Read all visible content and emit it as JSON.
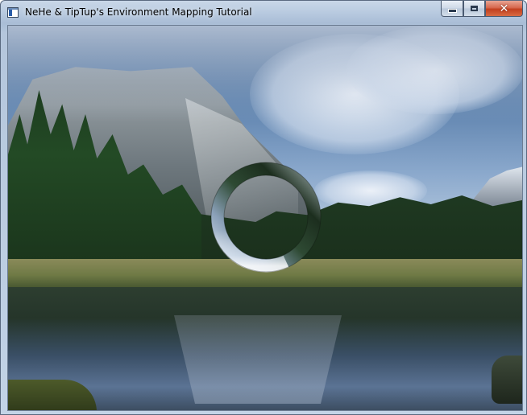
{
  "window": {
    "title": "NeHe & TipTup's Environment Mapping Tutorial",
    "controls": {
      "minimize_icon": "minimize-icon",
      "maximize_icon": "maximize-icon",
      "close_icon": "close-icon",
      "close_glyph": "✕"
    }
  },
  "scene": {
    "background": "yosemite-valley-photo",
    "object": "environment-mapped-torus"
  },
  "colors": {
    "titlebar": "#b9cbe0",
    "close_button": "#c2401f",
    "frame_border": "#5a6a80"
  }
}
